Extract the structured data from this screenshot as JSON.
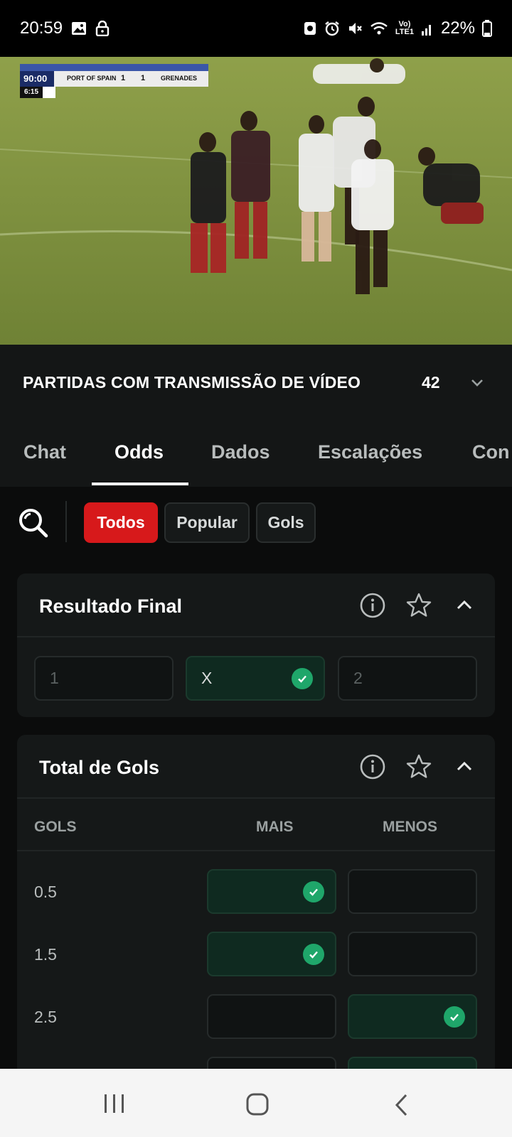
{
  "status_bar": {
    "time": "20:59",
    "battery": "22%",
    "network": "Vo)\nLTE1"
  },
  "video": {
    "scoreboard_time": "90:00",
    "home_team": "PORT OF SPAIN",
    "home_score": "1",
    "away_score": "1",
    "away_team": "GRENADES",
    "added_time": "6:15"
  },
  "match_header": {
    "title": "PARTIDAS COM TRANSMISSÃO DE VÍDEO",
    "count": "42"
  },
  "tabs": [
    {
      "label": "Chat"
    },
    {
      "label": "Odds",
      "active": true
    },
    {
      "label": "Dados"
    },
    {
      "label": "Escalações"
    },
    {
      "label": "Con"
    }
  ],
  "filters": [
    {
      "label": "Todos",
      "active": true
    },
    {
      "label": "Popular"
    },
    {
      "label": "Gols"
    }
  ],
  "resultado_final": {
    "title": "Resultado Final",
    "options": [
      {
        "label": "1",
        "selected": false
      },
      {
        "label": "X",
        "selected": true
      },
      {
        "label": "2",
        "selected": false
      }
    ]
  },
  "total_gols": {
    "title": "Total de Gols",
    "columns": {
      "gols": "GOLS",
      "mais": "MAIS",
      "menos": "MENOS"
    },
    "rows": [
      {
        "line": "0.5",
        "mais_selected": true,
        "menos_selected": false
      },
      {
        "line": "1.5",
        "mais_selected": true,
        "menos_selected": false
      },
      {
        "line": "2.5",
        "mais_selected": false,
        "menos_selected": true
      }
    ]
  },
  "colors": {
    "accent_red": "#d7191b",
    "check_green": "#1fa66a",
    "selected_bg": "#0f2a20"
  },
  "icons": [
    "image-icon",
    "lock-icon",
    "alarm-icon",
    "mute-icon",
    "wifi-icon",
    "signal-icon",
    "battery-icon",
    "chevron-down-icon",
    "search-icon",
    "info-icon",
    "star-icon",
    "chevron-up-icon",
    "check-icon",
    "recents-icon",
    "home-icon",
    "back-icon"
  ]
}
